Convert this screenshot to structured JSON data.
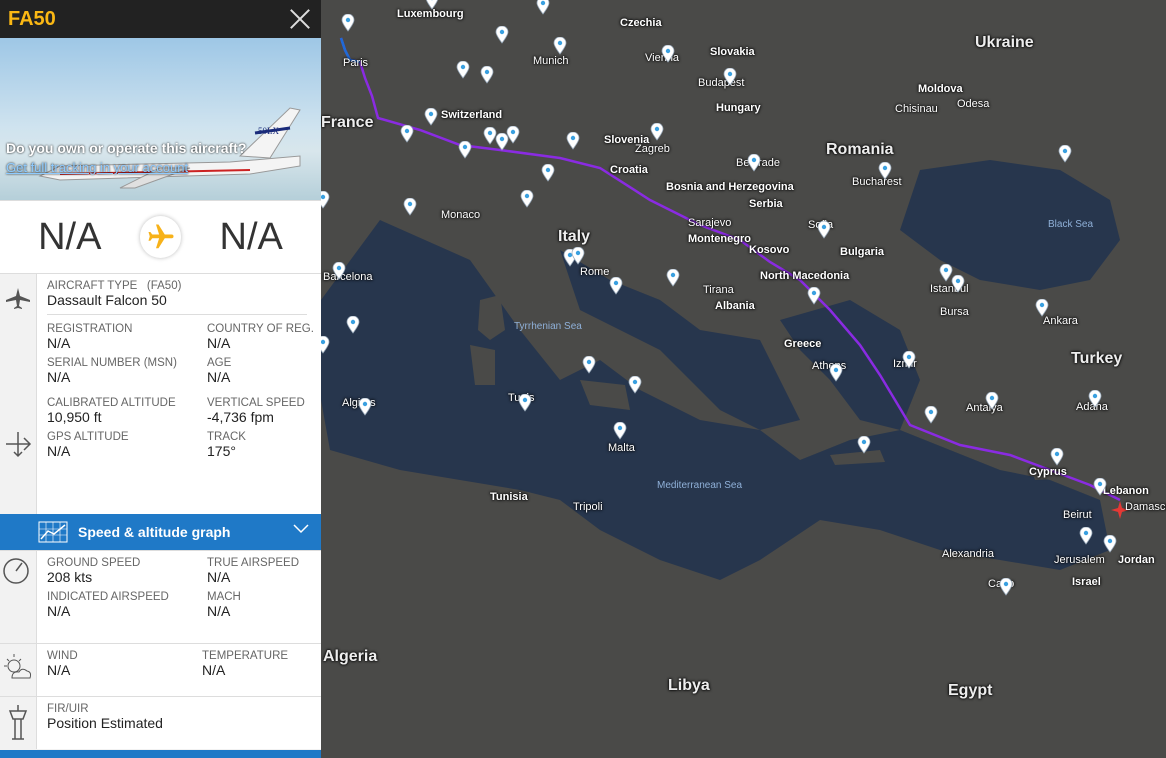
{
  "flight": {
    "callsign": "FA50"
  },
  "photo": {
    "prompt": "Do you own or operate this aircraft?",
    "link": "Get full tracking in your account",
    "registration_on_tail": "50LX"
  },
  "route": {
    "origin": "N/A",
    "destination": "N/A"
  },
  "aircraft": {
    "type_label": "AIRCRAFT TYPE",
    "type_code": "(FA50)",
    "type_value": "Dassault Falcon 50",
    "registration_label": "REGISTRATION",
    "registration_value": "N/A",
    "country_label": "COUNTRY OF REG.",
    "country_value": "N/A",
    "serial_label": "SERIAL NUMBER (MSN)",
    "serial_value": "N/A",
    "age_label": "AGE",
    "age_value": "N/A"
  },
  "altitude": {
    "cal_label": "CALIBRATED ALTITUDE",
    "cal_value": "10,950 ft",
    "vs_label": "VERTICAL SPEED",
    "vs_value": "-4,736 fpm",
    "gps_label": "GPS ALTITUDE",
    "gps_value": "N/A",
    "track_label": "TRACK",
    "track_value": "175°"
  },
  "graph": {
    "label": "Speed & altitude graph"
  },
  "speed": {
    "gs_label": "GROUND SPEED",
    "gs_value": "208 kts",
    "tas_label": "TRUE AIRSPEED",
    "tas_value": "N/A",
    "ias_label": "INDICATED AIRSPEED",
    "ias_value": "N/A",
    "mach_label": "MACH",
    "mach_value": "N/A"
  },
  "weather": {
    "wind_label": "WIND",
    "wind_value": "N/A",
    "temp_label": "TEMPERATURE",
    "temp_value": "N/A"
  },
  "fir": {
    "label": "FIR/UIR",
    "value": "Position Estimated"
  },
  "map": {
    "countries": [
      "Ukraine",
      "France",
      "Romania",
      "Italy",
      "Bulgaria",
      "Greece",
      "Turkey",
      "Algeria",
      "Libya",
      "Egypt",
      "Tunisia",
      "Hungary",
      "Slovenia",
      "Croatia",
      "Bosnia and Herzegovina",
      "Montenegro",
      "Kosovo",
      "North Macedonia",
      "Albania",
      "Serbia",
      "Moldova",
      "Slovakia",
      "Czechia",
      "Switzerland",
      "Luxembourg",
      "Cyprus",
      "Lebanon",
      "Israel",
      "Jordan"
    ],
    "cities": [
      "Munich",
      "Vienna",
      "Budapest",
      "Zagreb",
      "Belgrade",
      "Sarajevo",
      "Sofia",
      "Bucharest",
      "Chisinau",
      "Odesa",
      "Monaco",
      "Rome",
      "Tirana",
      "Athens",
      "Izmir",
      "Istanbul",
      "Bursa",
      "Ankara",
      "Antalya",
      "Adana",
      "Algiers",
      "Tunis",
      "Tripoli",
      "Malta",
      "Alexandria",
      "Cairo",
      "Jerusalem",
      "Beirut",
      "Damascus",
      "Paris",
      "Barcelona"
    ],
    "seas": [
      "Black Sea",
      "Tyrrhenian Sea",
      "Mediterranean Sea"
    ],
    "colors": {
      "track": "#8a2be2",
      "track_start": "#1e6bd6",
      "land": "#4a4a4a",
      "sea": "#27364d"
    }
  }
}
